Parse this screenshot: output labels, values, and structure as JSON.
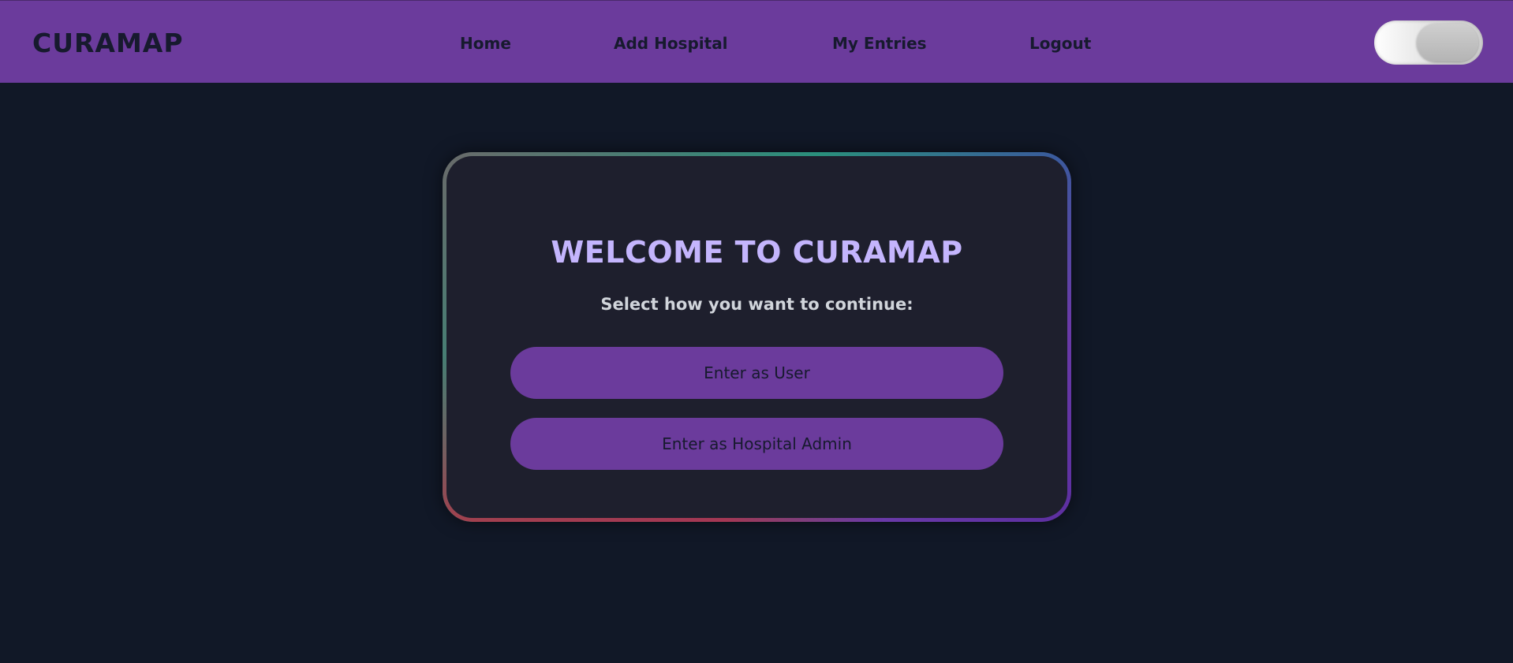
{
  "header": {
    "logo": "CURAMAP",
    "nav": {
      "home": "Home",
      "add_hospital": "Add Hospital",
      "my_entries": "My Entries",
      "logout": "Logout"
    },
    "theme_toggle": {
      "icon": "toggle-switch",
      "state": "off"
    }
  },
  "card": {
    "title": "WELCOME TO CURAMAP",
    "subtitle": "Select how you want to continue:",
    "buttons": {
      "user": "Enter as User",
      "admin": "Enter as Hospital Admin"
    }
  },
  "colors": {
    "accent": "#6b3b9c",
    "background": "#111827",
    "card": "#1e1f2d",
    "title": "#c4b5fd"
  }
}
